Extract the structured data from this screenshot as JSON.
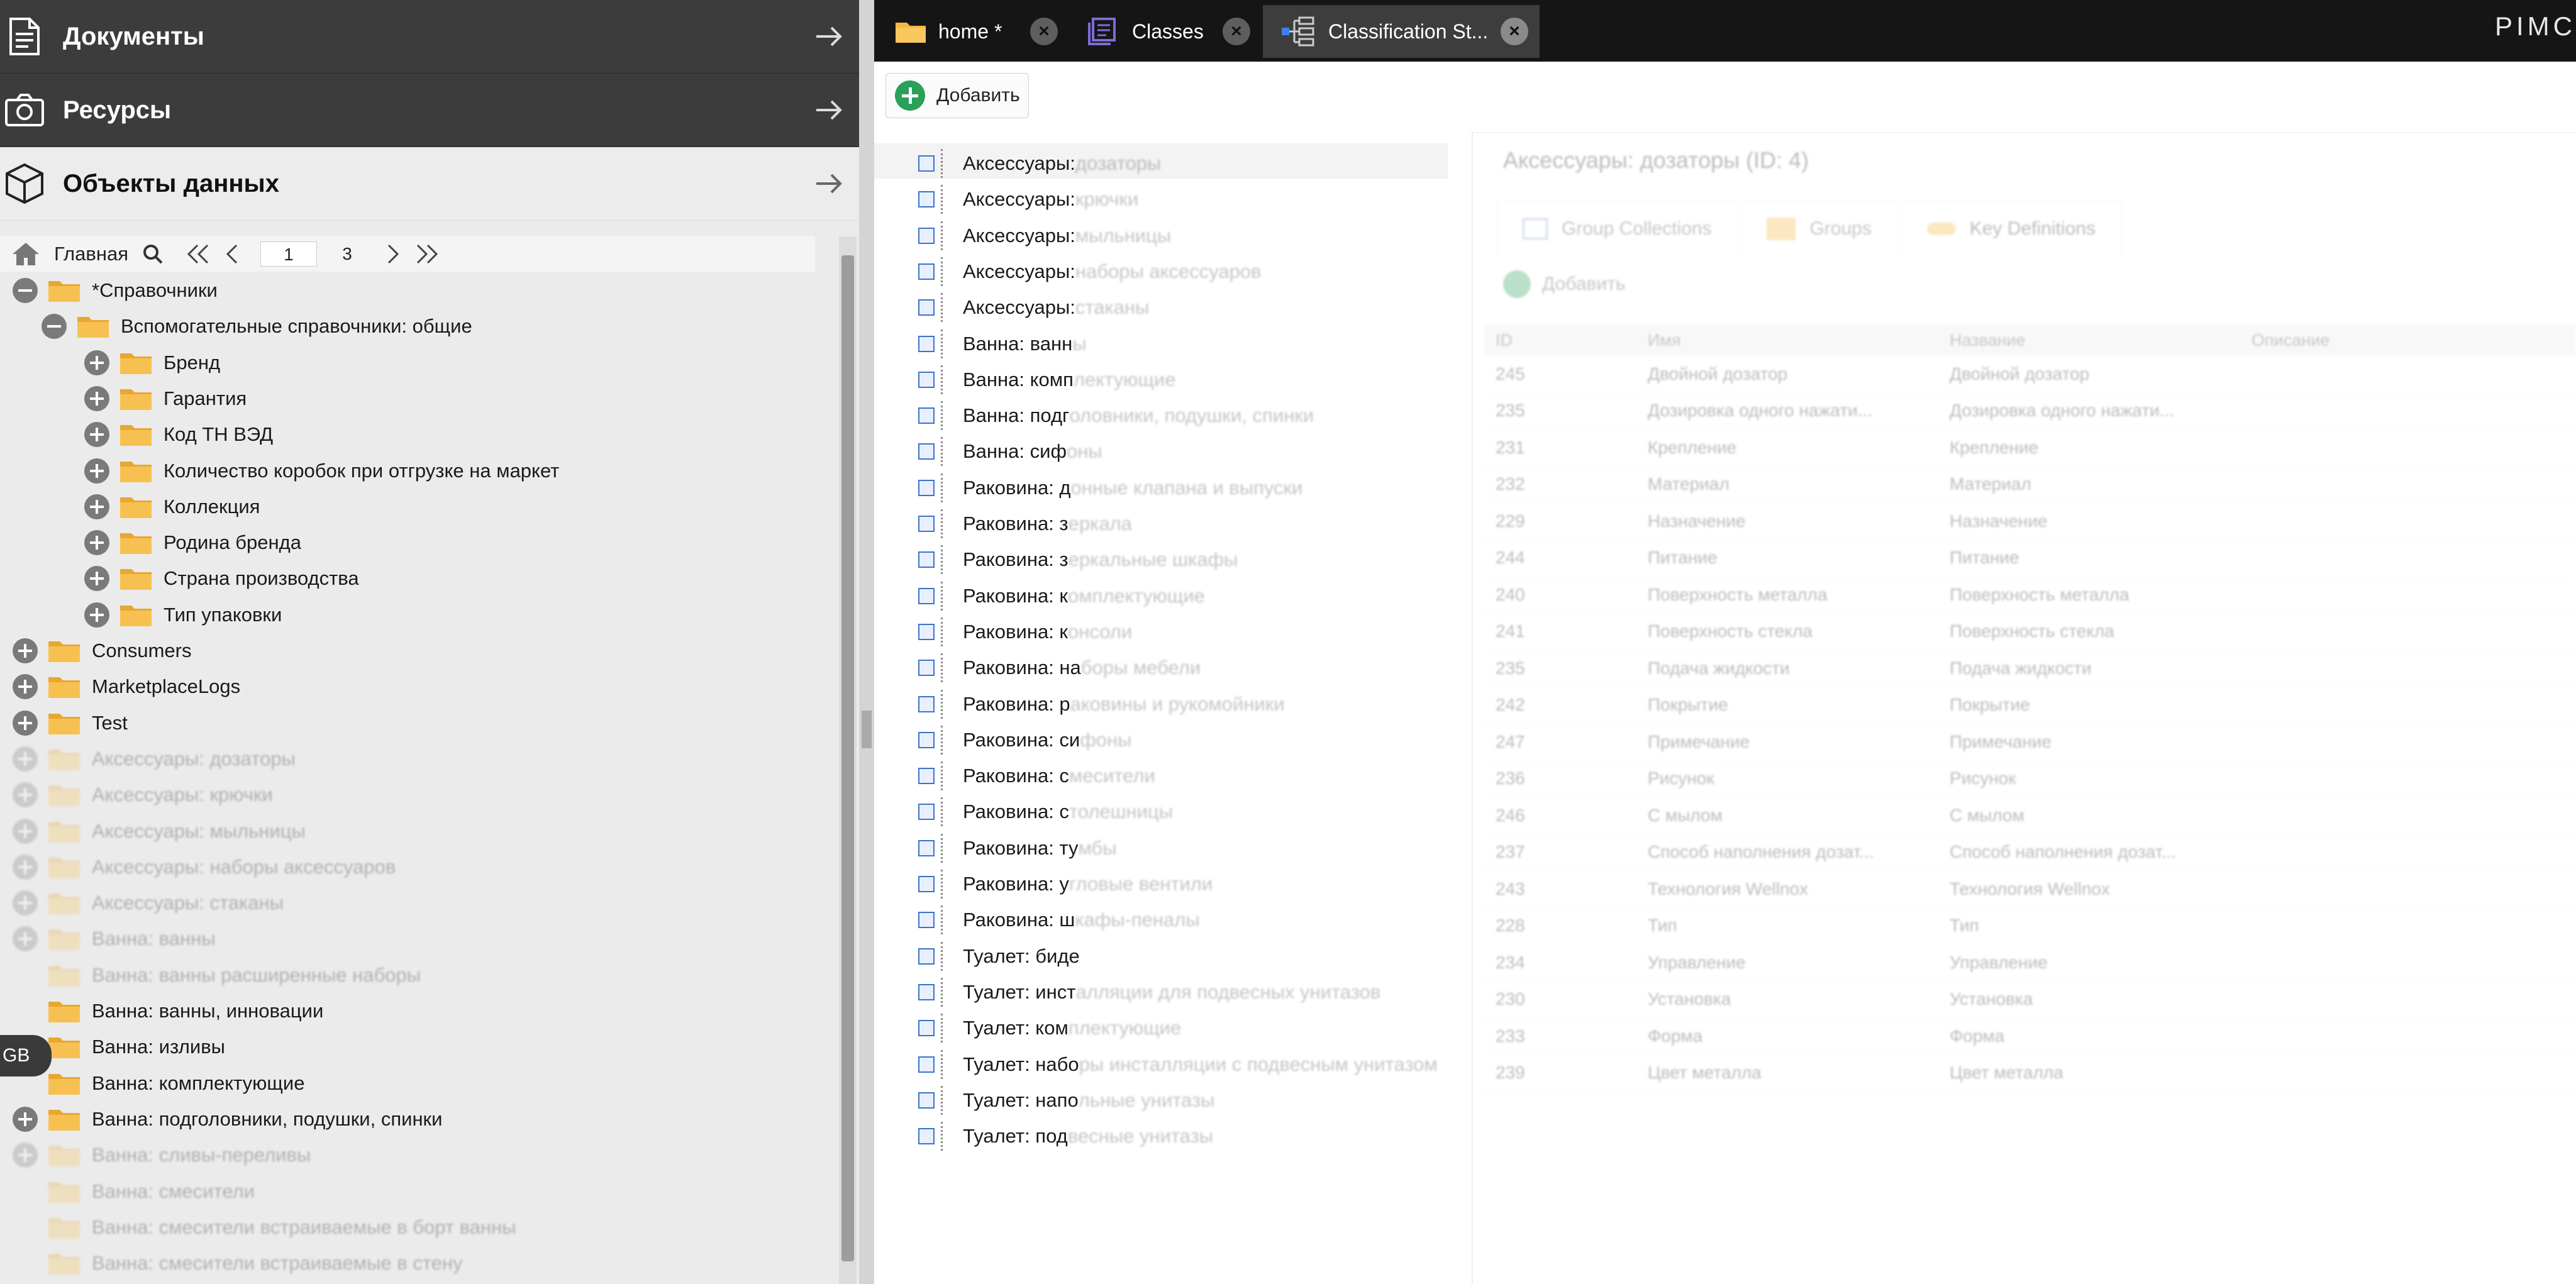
{
  "accordion": {
    "documents": "Документы",
    "assets": "Ресурсы",
    "data_objects": "Объекты данных"
  },
  "pager": {
    "home_label": "Главная",
    "page": "1",
    "total": "3"
  },
  "tree": [
    {
      "level": 0,
      "toggle": "minus",
      "label": "*Справочники",
      "faded": false
    },
    {
      "level": 1,
      "toggle": "minus",
      "label": "Вспомогательные справочники: общие",
      "faded": false
    },
    {
      "level": 2,
      "toggle": "plus",
      "label": "Бренд",
      "faded": false
    },
    {
      "level": 2,
      "toggle": "plus",
      "label": "Гарантия",
      "faded": false
    },
    {
      "level": 2,
      "toggle": "plus",
      "label": "Код ТН ВЭД",
      "faded": false
    },
    {
      "level": 2,
      "toggle": "plus",
      "label": "Количество коробок при отгрузке на маркет",
      "faded": false
    },
    {
      "level": 2,
      "toggle": "plus",
      "label": "Коллекция",
      "faded": false
    },
    {
      "level": 2,
      "toggle": "plus",
      "label": "Родина бренда",
      "faded": false
    },
    {
      "level": 2,
      "toggle": "plus",
      "label": "Страна производства",
      "faded": false
    },
    {
      "level": 2,
      "toggle": "plus",
      "label": "Тип упаковки",
      "faded": false
    },
    {
      "level": 0,
      "toggle": "plus",
      "label": "Consumers",
      "faded": false
    },
    {
      "level": 0,
      "toggle": "plus",
      "label": "MarketplaceLogs",
      "faded": false
    },
    {
      "level": 0,
      "toggle": "plus",
      "label": "Test",
      "faded": false
    },
    {
      "level": 0,
      "toggle": "plus",
      "label": "Аксессуары: дозаторы",
      "faded": true
    },
    {
      "level": 0,
      "toggle": "plus",
      "label": "Аксессуары: крючки",
      "faded": true
    },
    {
      "level": 0,
      "toggle": "plus",
      "label": "Аксессуары: мыльницы",
      "faded": true
    },
    {
      "level": 0,
      "toggle": "plus",
      "label": "Аксессуары: наборы аксессуаров",
      "faded": true
    },
    {
      "level": 0,
      "toggle": "plus",
      "label": "Аксессуары: стаканы",
      "faded": true
    },
    {
      "level": 0,
      "toggle": "plus",
      "label": "Ванна: ванны",
      "faded": true
    },
    {
      "level": 0,
      "toggle": "none",
      "label": "Ванна: ванны расширенные наборы",
      "faded": true
    },
    {
      "level": 0,
      "toggle": "none",
      "label": "Ванна: ванны, инновации",
      "faded": false
    },
    {
      "level": 0,
      "toggle": "none",
      "label": "Ванна: изливы",
      "faded": false
    },
    {
      "level": 0,
      "toggle": "none",
      "label": "Ванна: комплектующие",
      "faded": false
    },
    {
      "level": 0,
      "toggle": "plus",
      "label": "Ванна: подголовники, подушки, спинки",
      "faded": false
    },
    {
      "level": 0,
      "toggle": "plus",
      "label": "Ванна: сливы-переливы",
      "faded": true
    },
    {
      "level": 0,
      "toggle": "none",
      "label": "Ванна: смесители",
      "faded": true
    },
    {
      "level": 0,
      "toggle": "none",
      "label": "Ванна: смесители встраиваемые в борт ванны",
      "faded": true
    },
    {
      "level": 0,
      "toggle": "none",
      "label": "Ванна: смесители встраиваемые в стену",
      "faded": true
    }
  ],
  "lang_badge": "GB",
  "tabs": [
    {
      "label": "home *",
      "icon": "folder-icon"
    },
    {
      "label": "Classes",
      "icon": "classes-icon"
    },
    {
      "label": "Classification St...",
      "icon": "classification-store-icon"
    }
  ],
  "brand": "PIMC",
  "toolbar": {
    "add_label": "Добавить"
  },
  "collections": [
    {
      "head": "Аксессуары:",
      "tail": "дозаторы"
    },
    {
      "head": "Аксессуары:",
      "tail": "крючки"
    },
    {
      "head": "Аксессуары:",
      "tail": "мыльницы"
    },
    {
      "head": "Аксессуары:",
      "tail": "наборы аксессуаров"
    },
    {
      "head": "Аксессуары:",
      "tail": "стаканы"
    },
    {
      "head": "Ванна: ванн",
      "tail": "ы"
    },
    {
      "head": "Ванна: комп",
      "tail": "лектующие"
    },
    {
      "head": "Ванна: подг",
      "tail": "оловники, подушки, спинки"
    },
    {
      "head": "Ванна: сиф",
      "tail": "оны"
    },
    {
      "head": "Раковина: д",
      "tail": "онные клапана и выпуски"
    },
    {
      "head": "Раковина: з",
      "tail": "еркала"
    },
    {
      "head": "Раковина: з",
      "tail": "еркальные шкафы"
    },
    {
      "head": "Раковина: к",
      "tail": "омплектующие"
    },
    {
      "head": "Раковина: к",
      "tail": "онсоли"
    },
    {
      "head": "Раковина: на",
      "tail": "боры мебели"
    },
    {
      "head": "Раковина: р",
      "tail": "аковины и рукомойники"
    },
    {
      "head": "Раковина: си",
      "tail": "фоны"
    },
    {
      "head": "Раковина: с",
      "tail": "месители"
    },
    {
      "head": "Раковина: с",
      "tail": "толешницы"
    },
    {
      "head": "Раковина: ту",
      "tail": "мбы"
    },
    {
      "head": "Раковина: у",
      "tail": "гловые вентили"
    },
    {
      "head": "Раковина: ш",
      "tail": "кафы-пеналы"
    },
    {
      "head": "Туалет: биде",
      "tail": ""
    },
    {
      "head": "Туалет: инст",
      "tail": "алляции для подвесных унитазов"
    },
    {
      "head": "Туалет: ком",
      "tail": "плектующие"
    },
    {
      "head": "Туалет: набо",
      "tail": "ры инсталляции с подвесным унитазом"
    },
    {
      "head": "Туалет: напо",
      "tail": "льные унитазы"
    },
    {
      "head": "Туалет: под",
      "tail": "весные унитазы"
    }
  ],
  "detail": {
    "title": "Аксессуары: дозаторы (ID: 4)",
    "tabs": [
      "Group Collections",
      "Groups",
      "Key Definitions"
    ],
    "add_label": "Добавить",
    "columns": [
      "ID",
      "Имя",
      "Название",
      "Описание"
    ],
    "rows": [
      [
        "245",
        "Двойной дозатор",
        "Двойной дозатор",
        ""
      ],
      [
        "235",
        "Дозировка одного нажати...",
        "Дозировка одного нажати...",
        ""
      ],
      [
        "231",
        "Крепление",
        "Крепление",
        ""
      ],
      [
        "232",
        "Материал",
        "Материал",
        ""
      ],
      [
        "229",
        "Назначение",
        "Назначение",
        ""
      ],
      [
        "244",
        "Питание",
        "Питание",
        ""
      ],
      [
        "240",
        "Поверхность металла",
        "Поверхность металла",
        ""
      ],
      [
        "241",
        "Поверхность стекла",
        "Поверхность стекла",
        ""
      ],
      [
        "235",
        "Подача жидкости",
        "Подача жидкости",
        ""
      ],
      [
        "242",
        "Покрытие",
        "Покрытие",
        ""
      ],
      [
        "247",
        "Примечание",
        "Примечание",
        ""
      ],
      [
        "236",
        "Рисунок",
        "Рисунок",
        ""
      ],
      [
        "246",
        "С мылом",
        "С мылом",
        ""
      ],
      [
        "237",
        "Способ наполнения дозат...",
        "Способ наполнения дозат...",
        ""
      ],
      [
        "243",
        "Технология Wellnox",
        "Технология Wellnox",
        ""
      ],
      [
        "228",
        "Тип",
        "Тип",
        ""
      ],
      [
        "234",
        "Управление",
        "Управление",
        ""
      ],
      [
        "230",
        "Установка",
        "Установка",
        ""
      ],
      [
        "233",
        "Форма",
        "Форма",
        ""
      ],
      [
        "239",
        "Цвет металла",
        "Цвет металла",
        ""
      ]
    ]
  },
  "colors": {
    "folder": "#f5b844",
    "accent_green": "#2aa05a",
    "dark_bar": "#151515"
  }
}
